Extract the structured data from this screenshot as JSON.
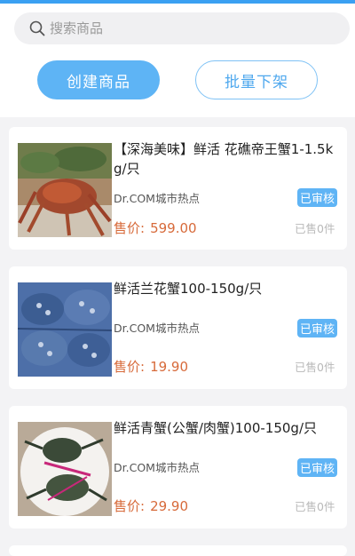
{
  "search": {
    "placeholder": "搜索商品"
  },
  "actions": {
    "create_label": "创建商品",
    "batch_label": "批量下架"
  },
  "products": [
    {
      "title": "【深海美味】鲜活 花礁帝王蟹1-1.5kg/只",
      "store": "Dr.COM城市热点",
      "status": "已审核",
      "price_label": "售价:",
      "price": "599.00",
      "sold": "已售0件"
    },
    {
      "title": "鲜活兰花蟹100-150g/只",
      "store": "Dr.COM城市热点",
      "status": "已审核",
      "price_label": "售价:",
      "price": "19.90",
      "sold": "已售0件"
    },
    {
      "title": "鲜活青蟹(公蟹/肉蟹)100-150g/只",
      "store": "Dr.COM城市热点",
      "status": "已审核",
      "price_label": "售价:",
      "price": "29.90",
      "sold": "已售0件"
    }
  ],
  "colors": {
    "accent": "#5eb4f5",
    "price": "#d76a3a",
    "background": "#f3f3f5"
  }
}
